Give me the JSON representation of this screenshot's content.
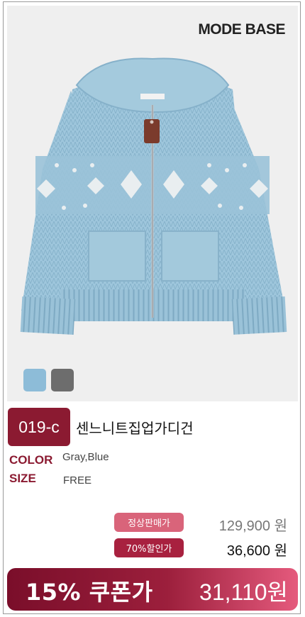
{
  "brand": {
    "logo_text": "MODE BASE"
  },
  "product": {
    "image_icon": "knit-cardigan-photo",
    "swatches": [
      {
        "name": "swatch-blue",
        "color": "#8dbcd8"
      },
      {
        "name": "swatch-gray",
        "color": "#6d6d6d"
      }
    ],
    "code": "019-c",
    "name": "센느니트집업가디건",
    "color_label": "COLOR",
    "color_value": "Gray,Blue",
    "size_label": "SIZE",
    "size_value": "FREE"
  },
  "pricing": {
    "regular_label": "정상판매가",
    "regular_price": "129,900 원",
    "discount_label": "70%할인가",
    "discount_price": "36,600 원",
    "coupon_label": "15% 쿠폰가",
    "coupon_price": "31,110원"
  },
  "colors": {
    "accent": "#8b1a31",
    "regular_badge": "#d9647a",
    "discount_badge": "#a8213f"
  }
}
